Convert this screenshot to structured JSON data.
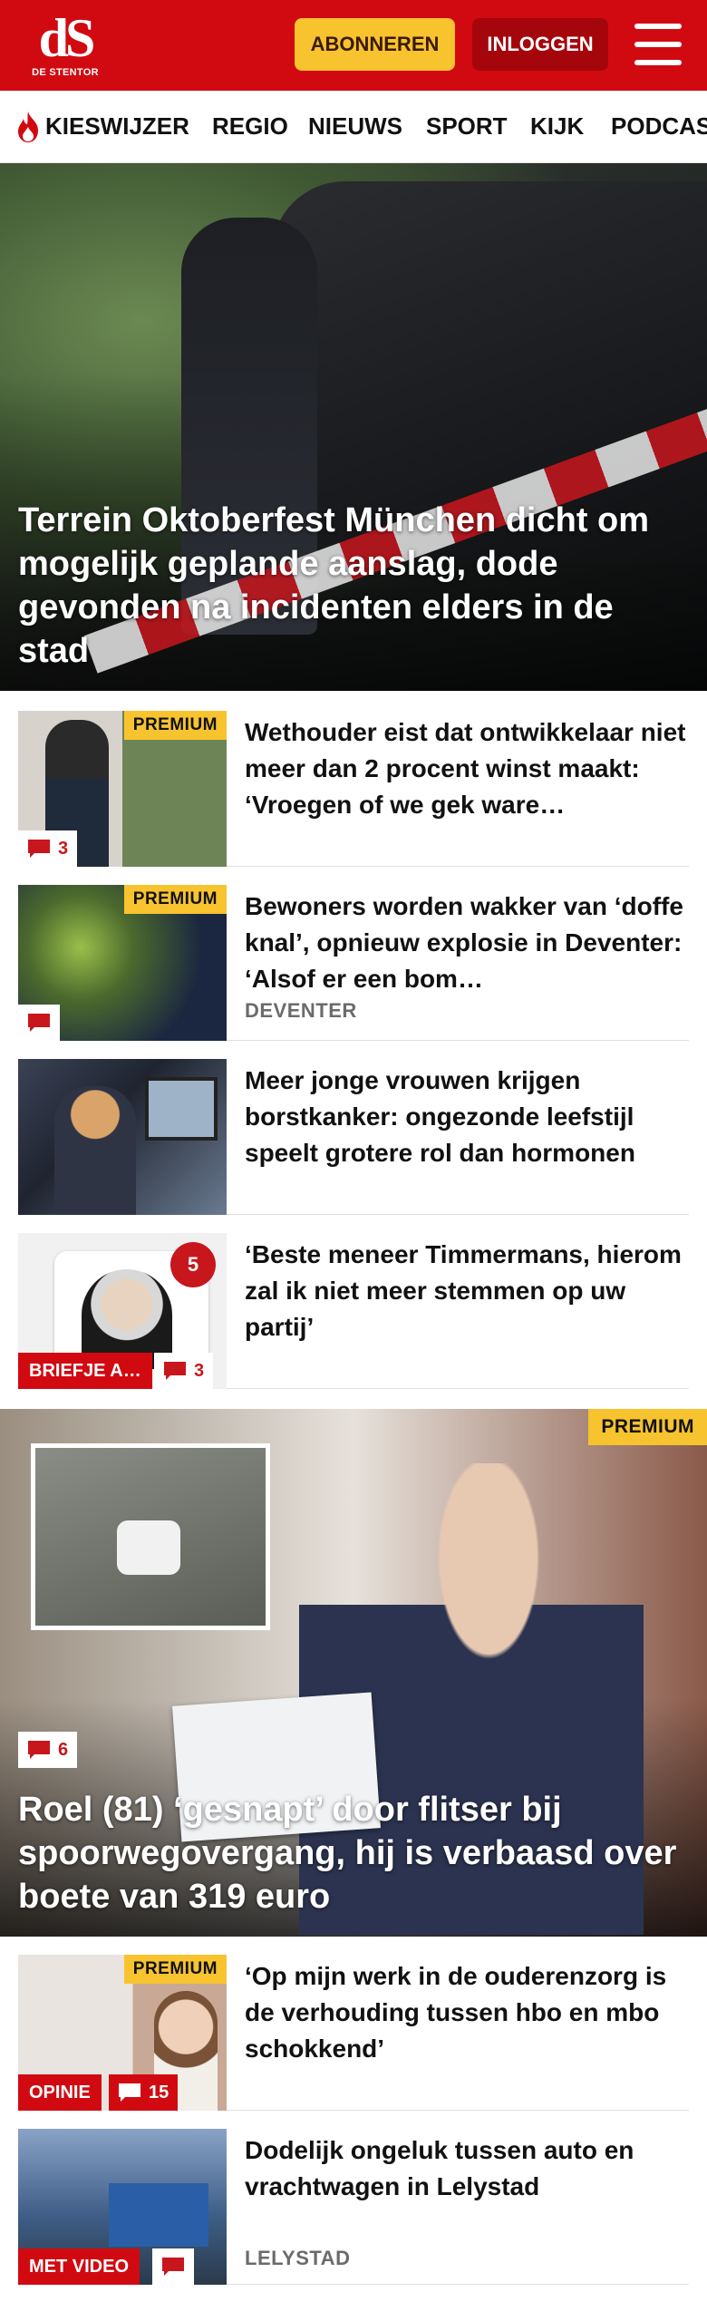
{
  "header": {
    "logo_main": "dS",
    "logo_sub": "DE STENTOR",
    "subscribe_label": "ABONNEREN",
    "login_label": "INLOGGEN",
    "brand_color": "#d10a11"
  },
  "nav": {
    "items": [
      "KIESWIJZER",
      "REGIO",
      "NIEUWS",
      "SPORT",
      "KIJK",
      "PODCAST"
    ]
  },
  "hero": {
    "title": "Terrein Oktoberfest München dicht om mogelijk geplande aanslag, dode gevonden na incidenten elders in de stad"
  },
  "articles": [
    {
      "title": "Wethouder eist dat ontwikkelaar niet meer dan 2 procent winst maakt: ‘Vroegen of we gek ware…",
      "premium": "PREMIUM",
      "comments": "3"
    },
    {
      "title": "Bewoners worden wakker van ‘doffe knal’, opnieuw explosie in Deventer: ‘Alsof er een bom…",
      "premium": "PREMIUM",
      "location": "DEVENTER",
      "comments": ""
    },
    {
      "title": "Meer jonge vrouwen krijgen borstkanker: ongezonde leefstijl speelt grotere rol dan hormonen"
    },
    {
      "title": "‘Beste meneer Timmermans, hierom zal ik niet meer stemmen op uw partij’",
      "tag": "BRIEFJE A…",
      "comments": "3",
      "badge": "5"
    }
  ],
  "feature": {
    "title": "Roel (81) ‘gesnapt’ door flitser bij spoorwegovergang, hij is verbaasd over boete van 319 euro",
    "premium": "PREMIUM",
    "comments": "6"
  },
  "articles2": [
    {
      "title": "‘Op mijn werk in de ouderenzorg is de verhouding tussen hbo en mbo schokkend’",
      "premium": "PREMIUM",
      "tag": "OPINIE",
      "comments": "15"
    },
    {
      "title": "Dodelijk ongeluk tussen auto en vrachtwagen in Lelystad",
      "tag": "MET VIDEO",
      "location": "LELYSTAD",
      "comments": ""
    }
  ]
}
